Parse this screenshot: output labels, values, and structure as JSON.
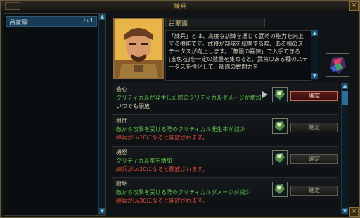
{
  "window": {
    "title": "練兵"
  },
  "left_panel": {
    "character": {
      "name": "呂蒙團",
      "level": "Lv1"
    }
  },
  "general": {
    "name": "呂蒙團",
    "description": "「練兵」とは、高度な訓練を通じて武将の能力を向上する機能です。武将が部隊を統率する際、ある種のステータスが向上します。「無限の鍛錬」で入手できる[五色石]を一定の数量を集めると、武将のある種のステータスを強化して、部隊の戦闘力を"
  },
  "skills": [
    {
      "name": "会心",
      "desc": "クリティカルが発生した際のクリティカルダメージが増加",
      "cond": "いつでも開放",
      "button": "確定",
      "active": true
    },
    {
      "name": "根性",
      "desc": "敵から攻撃を受ける際のクリティカル発生率が減少",
      "cond": "練兵がLv10になると開放されます。",
      "button": "確定",
      "active": false
    },
    {
      "name": "機怒",
      "desc": "クリティカル率を増加",
      "cond": "練兵がLv20になると開放されます。",
      "button": "確定",
      "active": false
    },
    {
      "name": "耐酷",
      "desc": "敵から攻撃を受ける際のクリティカルダメージが減少",
      "cond": "練兵がLv30になると開放されます。",
      "button": "確定",
      "active": false
    }
  ],
  "icons": {
    "close": "close-icon",
    "gem": "gem-icon"
  },
  "colors": {
    "accent": "#c9a95b",
    "active_button": "#5a1a1a",
    "desc_green": "#5fbf4a",
    "cond_red": "#e04b3a"
  }
}
